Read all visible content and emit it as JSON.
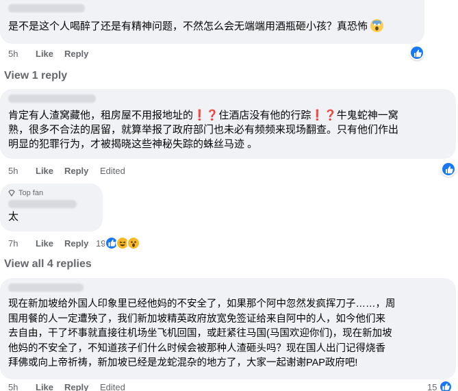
{
  "comments": [
    {
      "text": "是不是这个人喝醉了还是有精神问题，不然怎么会无端端用酒瓶砸小孩？真恐怖",
      "timestamp": "5h",
      "like": "Like",
      "reply": "Reply"
    },
    {
      "text_part1": "肯定有人渣窝藏他，租房屋不用报地址的",
      "text_part2": "住酒店没有他的行踪",
      "text_part3": "牛鬼蛇神一窝",
      "text_line2": "熟，很多不合法的居留，就算举报了政府部门也未必有频频来现场翻查。只有他们作出",
      "text_line3": "明显的犯罪行为，才被揭晓这些神秘失踪的蛛丝马迹 。",
      "timestamp": "5h",
      "like": "Like",
      "reply": "Reply",
      "edited": "Edited"
    },
    {
      "badge": "Top fan",
      "text": "太",
      "timestamp": "7h",
      "like": "Like",
      "reply": "Reply",
      "reaction_count": "19"
    },
    {
      "line1": "现在新加坡给外国人印象里已经他妈的不安全了，如果那个阿中忽然发疯挥刀子……，周",
      "line2": "围用餐的人一定遭殃了，我们新加坡精英政府放宽免签证给来自阿中的人，如今他们来",
      "line3": "去自由，干了坏事就直接往机场坐飞机回国，或赶紧往马国(马国欢迎你们)，现在新加坡",
      "line4": "他妈的不安全了，不知道孩子们什么时候会被那种人渣砸头吗？现在国人出门记得烧香",
      "line5": "拜佛或向上帝祈祷，新加坡已经是龙蛇混杂的地方了，大家一起谢谢PAP政府吧!",
      "timestamp": "5h",
      "like": "Like",
      "reply": "Reply",
      "edited": "Edited",
      "reaction_count": "15"
    }
  ],
  "view_1_reply": "View 1 reply",
  "view_all_4_replies": "View all 4 replies",
  "colors": {
    "like_blue": "#1877f2",
    "bubble": "#f0f2f5",
    "meta": "#65676b"
  }
}
